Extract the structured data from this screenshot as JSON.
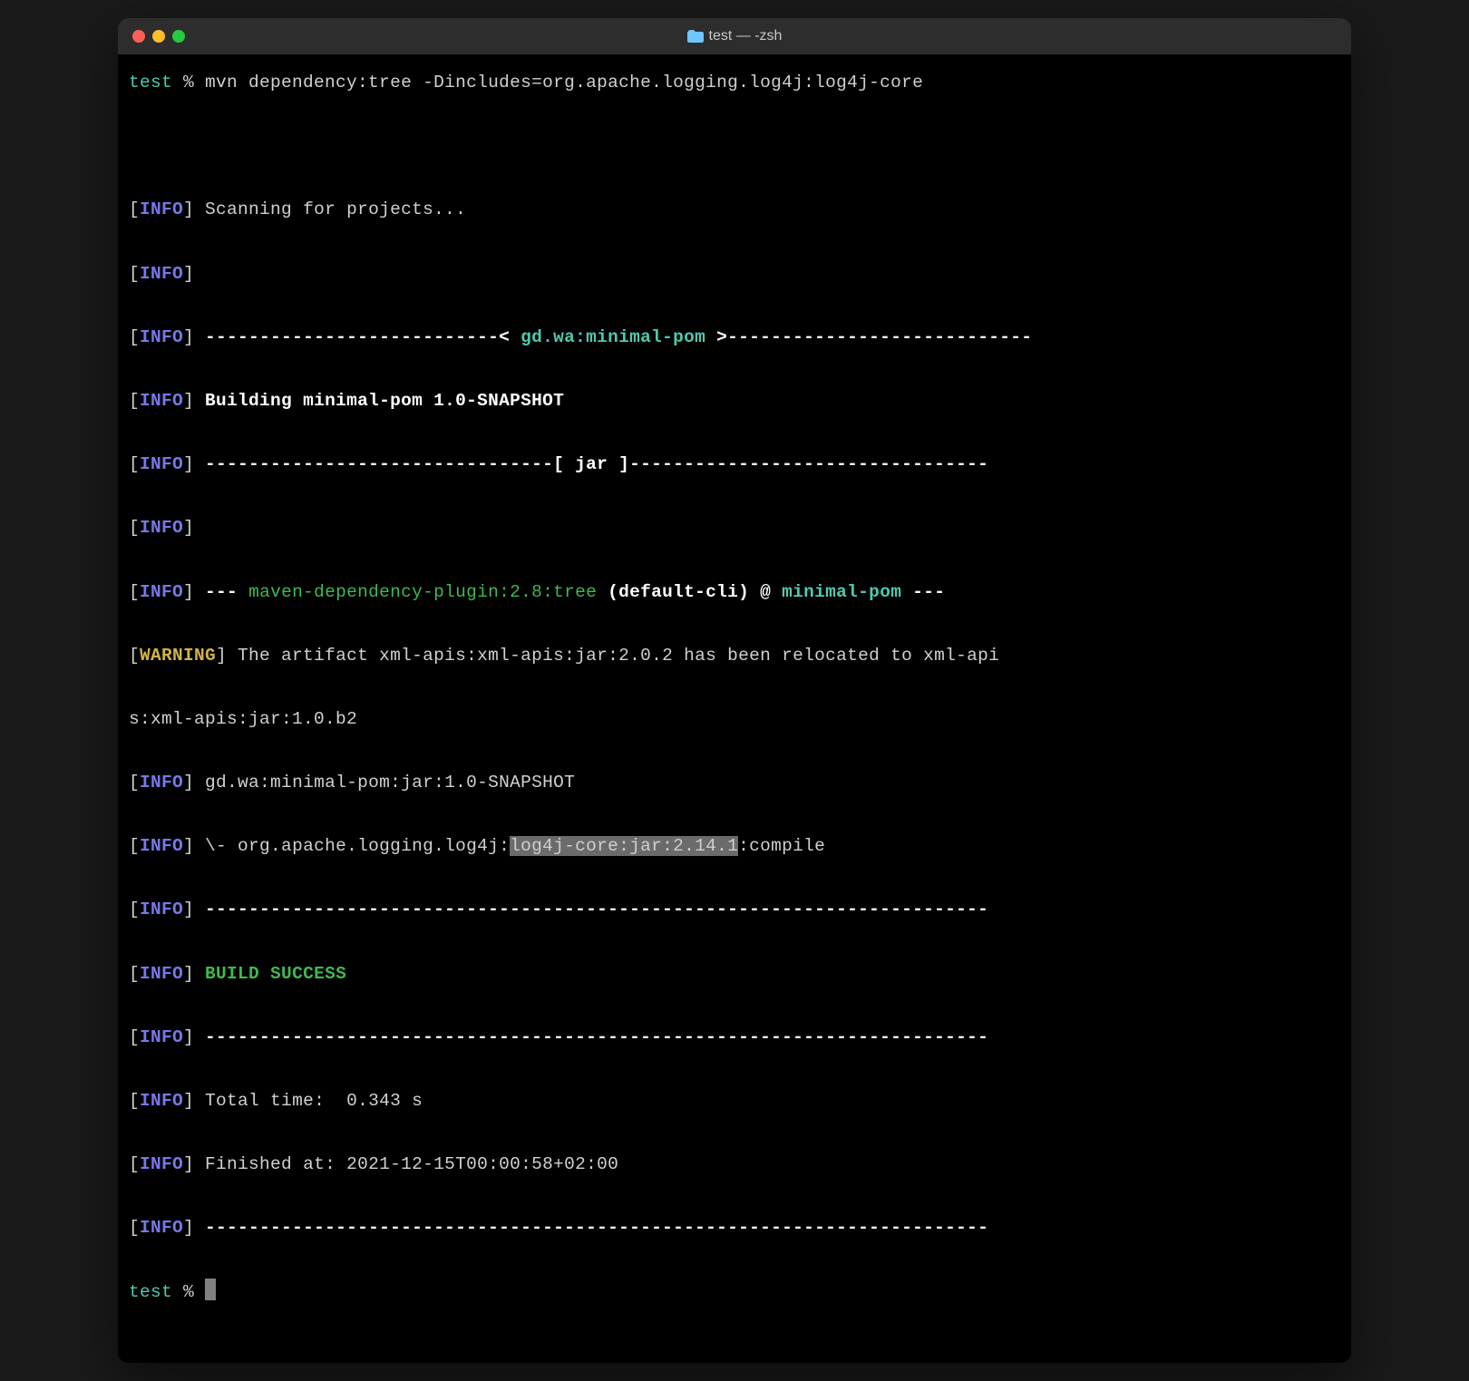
{
  "title_bar": {
    "title": "test — -zsh"
  },
  "lines": {
    "prompt1_dir": "test",
    "prompt1_marker": " % ",
    "prompt1_cmd": "mvn dependency:tree -Dincludes=org.apache.logging.log4j:log4j-core",
    "info_label": "INFO",
    "warning_label": "WARNING",
    "scanning": " Scanning for projects...",
    "dash_proj_pre": " ---------------------------< ",
    "proj_coords": "gd.wa:minimal-pom",
    "dash_proj_post": " >----------------------------",
    "building": " Building minimal-pom 1.0-SNAPSHOT",
    "jar_line": " --------------------------------[ jar ]---------------------------------",
    "plugin_pre": " --- ",
    "plugin_name": "maven-dependency-plugin:2.8:tree",
    "plugin_goal": " (default-cli)",
    "plugin_at": " @ ",
    "plugin_proj": "minimal-pom",
    "plugin_post": " ---",
    "warning_text": " The artifact xml-apis:xml-apis:jar:2.0.2 has been relocated to xml-api",
    "warning_cont": "s:xml-apis:jar:1.0.b2",
    "artifact1": " gd.wa:minimal-pom:jar:1.0-SNAPSHOT",
    "dep_pre": " \\- org.apache.logging.log4j:",
    "dep_highlight": "log4j-core:jar:2.14.1",
    "dep_post": ":compile",
    "dashes": " ------------------------------------------------------------------------",
    "build_success": " BUILD SUCCESS",
    "total_time": " Total time:  0.343 s",
    "finished_at": " Finished at: 2021-12-15T00:00:58+02:00",
    "prompt2_dir": "test",
    "prompt2_marker": " % "
  },
  "colors": {
    "cyan": "#4ec9b0",
    "purple": "#7878e8",
    "yellow": "#d0b344",
    "green": "#3fb950",
    "white": "#d0d0d0",
    "highlight_bg": "#6b6b6b"
  }
}
